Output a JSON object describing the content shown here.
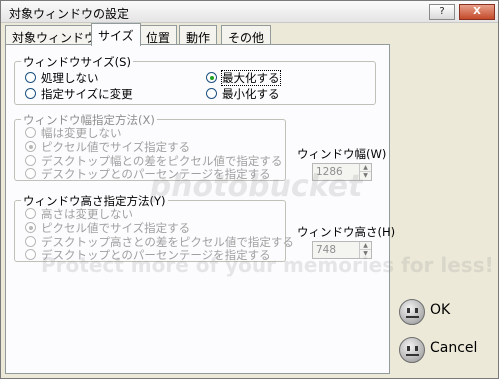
{
  "window": {
    "title": "対象ウィンドウの設定",
    "help_glyph": "?",
    "close_glyph": "X"
  },
  "tabs": [
    {
      "label": "対象ウィンドウ",
      "active": false
    },
    {
      "label": "サイズ",
      "active": true
    },
    {
      "label": "位置",
      "active": false
    },
    {
      "label": "動作",
      "active": false
    },
    {
      "label": "その他",
      "active": false
    }
  ],
  "window_size_group": {
    "label": "ウィンドウサイズ(S)",
    "options": [
      {
        "label": "処理しない",
        "selected": false
      },
      {
        "label": "指定サイズに変更",
        "selected": false
      },
      {
        "label": "最大化する",
        "selected": true
      },
      {
        "label": "最小化する",
        "selected": false
      }
    ]
  },
  "width_group": {
    "label": "ウィンドウ幅指定方法(X)",
    "options": [
      {
        "label": "幅は変更しない",
        "selected": false
      },
      {
        "label": "ピクセル値でサイズ指定する",
        "selected": true
      },
      {
        "label": "デスクトップ幅との差をピクセル値で指定する",
        "selected": false
      },
      {
        "label": "デスクトップとのパーセンテージを指定する",
        "selected": false
      }
    ],
    "field_label": "ウィンドウ幅(W)",
    "field_value": "1286"
  },
  "height_group": {
    "label": "ウィンドウ高さ指定方法(Y)",
    "options": [
      {
        "label": "高さは変更しない",
        "selected": false
      },
      {
        "label": "ピクセル値でサイズ指定する",
        "selected": true
      },
      {
        "label": "デスクトップ高さとの差をピクセル値で指定する",
        "selected": false
      },
      {
        "label": "デスクトップとのパーセンテージを指定する",
        "selected": false
      }
    ],
    "field_label": "ウィンドウ高さ(H)",
    "field_value": "748"
  },
  "buttons": {
    "ok": "OK",
    "cancel": "Cancel"
  },
  "watermark": {
    "brand": "photobucket",
    "tagline": "Protect more of your memories for less!"
  }
}
